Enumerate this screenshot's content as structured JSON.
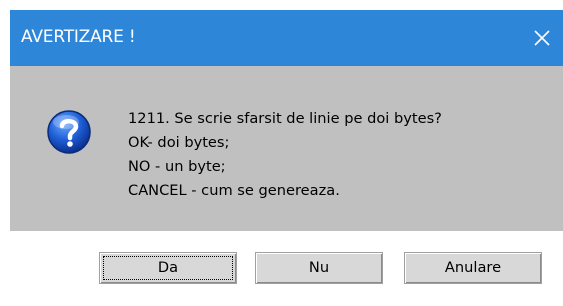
{
  "window": {
    "title": "AVERTIZARE !",
    "title_bar_color": "#2e86d9",
    "close_icon": "close-icon"
  },
  "message": {
    "icon": "question-icon",
    "lines": [
      "1211. Se scrie sfarsit de linie pe doi bytes?",
      "OK- doi bytes;",
      "NO - un byte;",
      "CANCEL - cum se genereaza."
    ]
  },
  "buttons": {
    "yes_label": "Da",
    "no_label": "Nu",
    "cancel_label": "Anulare"
  }
}
